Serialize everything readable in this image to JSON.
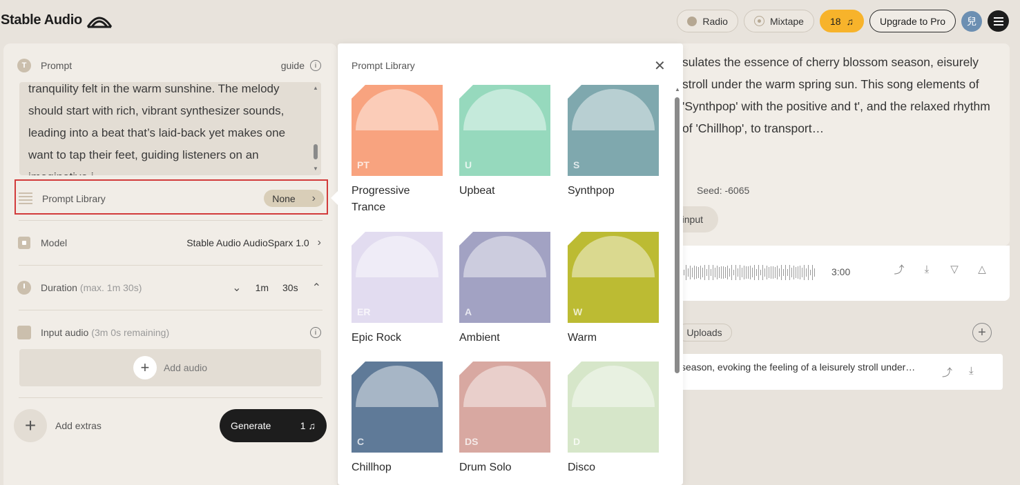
{
  "app": {
    "title": "Stable Audio"
  },
  "topbar": {
    "radio": "Radio",
    "mixtape": "Mixtape",
    "credits": "18",
    "upgrade": "Upgrade to Pro",
    "avatar_initial": "兒"
  },
  "left": {
    "prompt_label": "Prompt",
    "guide_label": "guide",
    "prompt_text": "tranquility felt in the warm sunshine. The melody should start with rich, vibrant synthesizer sounds, leading into a beat that’s laid-back yet makes one want to tap their feet, guiding listeners on an imaginative j",
    "library_label": "Prompt Library",
    "library_value": "None",
    "model_label": "Model",
    "model_value": "Stable Audio AudioSparx 1.0",
    "duration_label": "Duration",
    "duration_hint": "(max. 1m 30s)",
    "duration_min": "1m",
    "duration_sec": "30s",
    "input_label": "Input audio",
    "input_hint": "(3m 0s remaining)",
    "add_audio": "Add audio",
    "add_extras": "Add extras",
    "generate": "Generate",
    "generate_cost": "1"
  },
  "library": {
    "title": "Prompt Library",
    "items": [
      {
        "abbr": "PT",
        "name": "Progressive Trance",
        "color": "#f8a37f"
      },
      {
        "abbr": "U",
        "name": "Upbeat",
        "color": "#96d9bd"
      },
      {
        "abbr": "S",
        "name": "Synthpop",
        "color": "#7fa8ae"
      },
      {
        "abbr": "ER",
        "name": "Epic Rock",
        "color": "#e2dcf0"
      },
      {
        "abbr": "A",
        "name": "Ambient",
        "color": "#a2a2c3"
      },
      {
        "abbr": "W",
        "name": "Warm",
        "color": "#bcbb33"
      },
      {
        "abbr": "C",
        "name": "Chillhop",
        "color": "#5f7a98"
      },
      {
        "abbr": "DS",
        "name": "Drum Solo",
        "color": "#d8a8a1"
      },
      {
        "abbr": "D",
        "name": "Disco",
        "color": "#d6e6c9"
      }
    ]
  },
  "right": {
    "description": "sulates the essence of cherry blossom season, eisurely stroll under the warm spring sun. This song elements of 'Synthpop' with the positive and t', and the relaxed rhythm of 'Chillhop', to transport…",
    "seed": "Seed: -6065",
    "input_pill": "s input",
    "duration": "3:00",
    "uploads": "Uploads",
    "list_item": "season, evoking the feeling of a leisurely stroll under…"
  }
}
